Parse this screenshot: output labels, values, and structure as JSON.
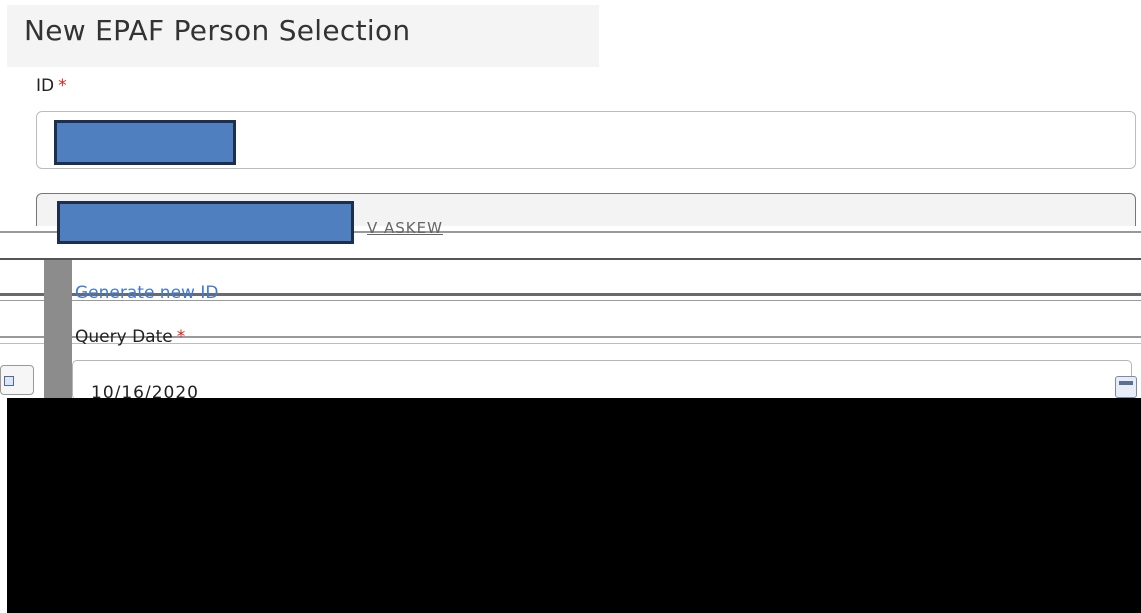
{
  "page": {
    "title": "New EPAF Person Selection"
  },
  "id_section": {
    "label": "ID",
    "required_marker": "*",
    "value_redacted": true
  },
  "name_section": {
    "value_redacted": true,
    "garbled_text": "V ASKEW"
  },
  "generate_link": {
    "label": "Generate new ID"
  },
  "query_date": {
    "label": "Query Date",
    "required_marker": "*",
    "value": "10/16/2020"
  },
  "icons": {
    "calendar": "calendar-icon"
  },
  "colors": {
    "required": "#d9201c",
    "link": "#3f7ad6",
    "redaction": "#4f7fbf"
  }
}
